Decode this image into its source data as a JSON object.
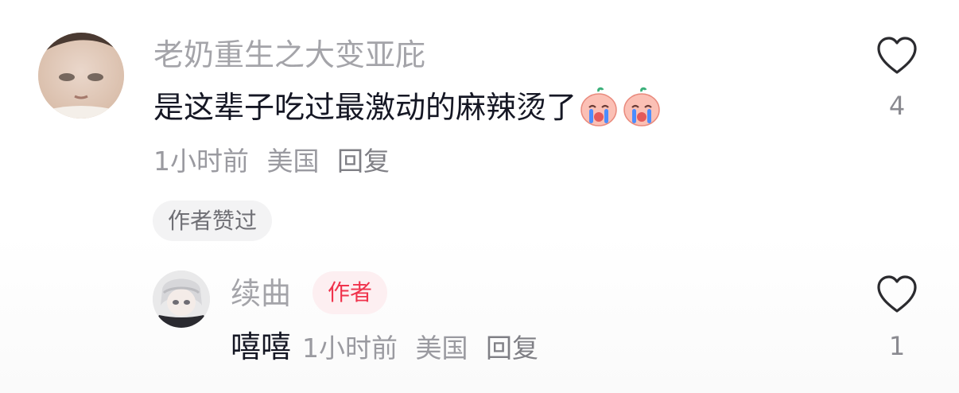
{
  "comment": {
    "username": "老奶重生之大变亚庇",
    "text": "是这辈子吃过最激动的麻辣烫了",
    "emojis": [
      "crying-emoji",
      "crying-emoji"
    ],
    "time": "1小时前",
    "location": "美国",
    "reply_label": "回复",
    "author_liked_label": "作者赞过",
    "like_count": "4",
    "avatar_icon": "user-photo-avatar"
  },
  "reply": {
    "username": "续曲",
    "badge": "作者",
    "text": "嘻嘻",
    "time": "1小时前",
    "location": "美国",
    "reply_label": "回复",
    "like_count": "1",
    "avatar_icon": "anime-character-avatar"
  },
  "colors": {
    "username": "#a4a4a9",
    "body_text": "#151724",
    "meta_text": "#9a9aa0",
    "author_badge_text": "#f0334c",
    "author_badge_bg": "#fdeff1",
    "chip_bg": "#f3f3f4",
    "heart_stroke": "#2b2b2f"
  }
}
